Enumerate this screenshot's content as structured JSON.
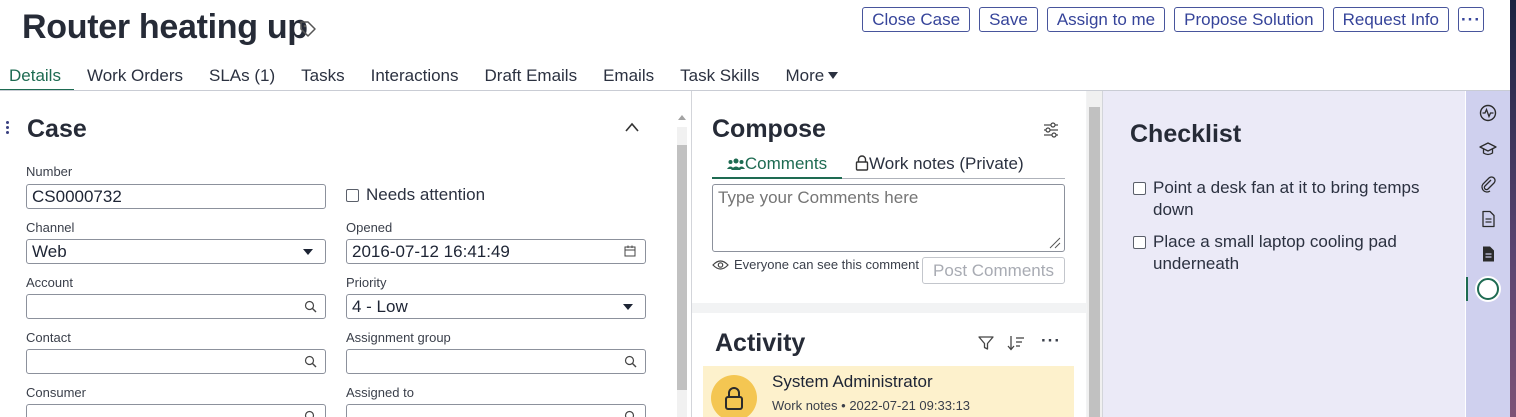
{
  "header": {
    "title": "Router heating up",
    "actions": [
      "Close Case",
      "Save",
      "Assign to me",
      "Propose Solution",
      "Request Info"
    ],
    "more_label": "···"
  },
  "tabs": [
    {
      "label": "Details",
      "active": true
    },
    {
      "label": "Work Orders"
    },
    {
      "label": "SLAs (1)"
    },
    {
      "label": "Tasks"
    },
    {
      "label": "Interactions"
    },
    {
      "label": "Draft Emails"
    },
    {
      "label": "Emails"
    },
    {
      "label": "Task Skills"
    },
    {
      "label": "More"
    }
  ],
  "case": {
    "title": "Case",
    "number_label": "Number",
    "number_value": "CS0000732",
    "needs_attention_label": "Needs attention",
    "channel_label": "Channel",
    "channel_value": "Web",
    "opened_label": "Opened",
    "opened_value": "2016-07-12 16:41:49",
    "account_label": "Account",
    "account_value": "",
    "priority_label": "Priority",
    "priority_value": "4 - Low",
    "contact_label": "Contact",
    "contact_value": "",
    "assignment_group_label": "Assignment group",
    "assignment_group_value": "",
    "consumer_label": "Consumer",
    "assigned_to_label": "Assigned to"
  },
  "compose": {
    "title": "Compose",
    "tab_comments": "Comments",
    "tab_worknotes": "Work notes (Private)",
    "placeholder": "Type your Comments here",
    "visibility_note": "Everyone can see this comment",
    "post_label": "Post Comments"
  },
  "activity": {
    "title": "Activity",
    "entries": [
      {
        "author": "System Administrator",
        "type": "Work notes",
        "timestamp": "2022-07-21 09:33:13"
      }
    ]
  },
  "checklist": {
    "title": "Checklist",
    "items": [
      "Point a desk fan at it to bring temps down",
      "Place a small laptop cooling pad underneath"
    ]
  },
  "colors": {
    "accent_green": "#1e6b52",
    "button_border": "#48559c",
    "work_note_bg": "#fdf1cc",
    "sidebar_bg": "#cfd0ee"
  },
  "icons": [
    "tag-icon",
    "drag-handle-icon",
    "chevron-up-icon",
    "calendar-icon",
    "search-icon",
    "settings-sliders-icon",
    "people-icon",
    "lock-icon",
    "eye-icon",
    "filter-icon",
    "sort-icon",
    "pulse-icon",
    "graduation-cap-icon",
    "paperclip-icon",
    "document-icon",
    "document-filled-icon",
    "circle-icon"
  ]
}
